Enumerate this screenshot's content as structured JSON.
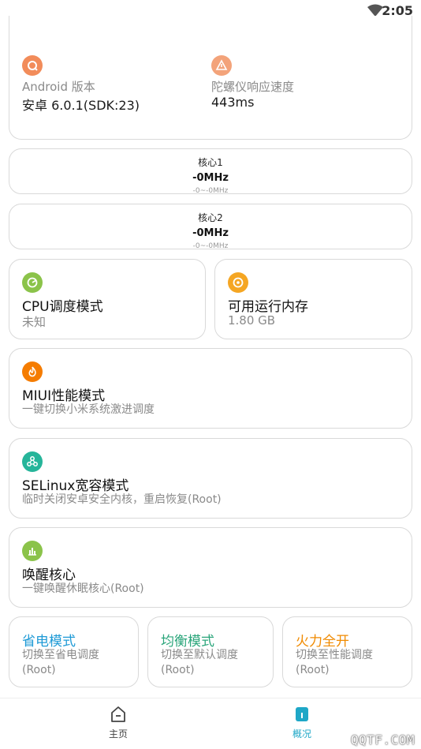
{
  "status_bar": {
    "time": "2:05"
  },
  "info_card": {
    "android": {
      "label": "Android 版本",
      "value": "安卓 6.0.1(SDK:23)",
      "icon": "android-icon",
      "color": "#f28c5a"
    },
    "gyro": {
      "label": "陀螺仪响应速度",
      "value": "443ms",
      "icon": "warning-icon",
      "color": "#f3a37a"
    }
  },
  "cores": [
    {
      "name": "核心1",
      "freq": "-0MHz",
      "range": "-0~-0MHz"
    },
    {
      "name": "核心2",
      "freq": "-0MHz",
      "range": "-0~-0MHz"
    }
  ],
  "cpu_governor": {
    "title": "CPU调度模式",
    "value": "未知",
    "icon": "pie-icon",
    "color": "#8bc34a"
  },
  "memory": {
    "title": "可用运行内存",
    "value": "1.80 GB",
    "icon": "memory-icon",
    "color": "#f5a623"
  },
  "modes": [
    {
      "title": "MIUI性能模式",
      "desc": "一键切换小米系统激进调度",
      "icon": "flame-icon",
      "color": "#f57c00"
    },
    {
      "title": "SELinux宽容模式",
      "desc": "临时关闭安卓安全内核，重启恢复(Root)",
      "icon": "molecule-icon",
      "color": "#26b59a"
    },
    {
      "title": "唤醒核心",
      "desc": "一键唤醒休眠核心(Root)",
      "icon": "chart-icon",
      "color": "#8bc34a"
    }
  ],
  "profiles": [
    {
      "title": "省电模式",
      "desc": "切换至省电调度(Root)",
      "color": "#1e9ad6"
    },
    {
      "title": "均衡模式",
      "desc": "切换至默认调度(Root)",
      "color": "#2aa57a"
    },
    {
      "title": "火力全开",
      "desc": "切换至性能调度(Root)",
      "color": "#f08a00"
    }
  ],
  "nav": {
    "home_label": "主页",
    "overview_label": "概况",
    "active_color": "#1ea7c7"
  },
  "watermark": "QQTF.COM"
}
